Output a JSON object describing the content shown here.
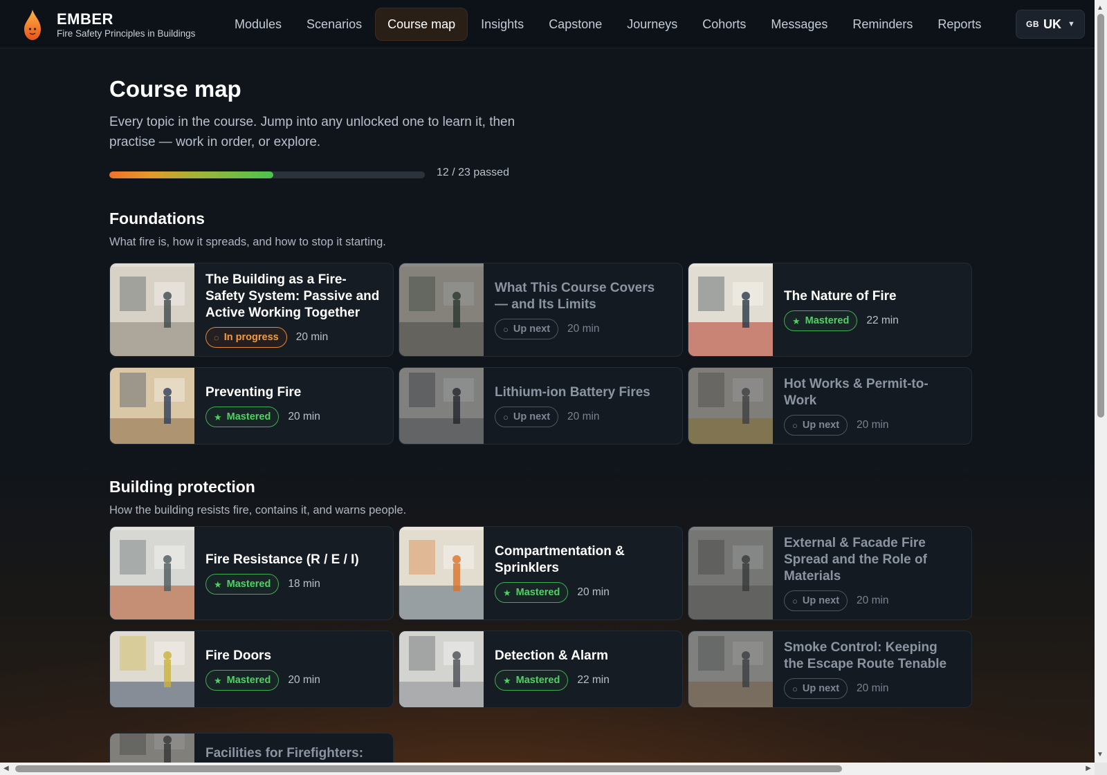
{
  "app": {
    "name": "EMBER",
    "subtitle": "Fire Safety Principles in Buildings",
    "logo_icon": "flame-icon"
  },
  "nav": {
    "items": [
      {
        "label": "Modules"
      },
      {
        "label": "Scenarios"
      },
      {
        "label": "Course map",
        "active": true
      },
      {
        "label": "Insights"
      },
      {
        "label": "Capstone"
      },
      {
        "label": "Journeys"
      },
      {
        "label": "Cohorts"
      },
      {
        "label": "Messages"
      },
      {
        "label": "Reminders"
      },
      {
        "label": "Reports"
      }
    ]
  },
  "language": {
    "flag": "GB",
    "code": "UK",
    "icon": "chevron-down-icon"
  },
  "page": {
    "title": "Course map",
    "description": "Every topic in the course. Jump into any unlocked one to learn it, then practise — work in order, or explore.",
    "progress": {
      "passed": 12,
      "total": 23,
      "fraction": 0.52,
      "label": "12 / 23 passed"
    }
  },
  "sections": [
    {
      "title": "Foundations",
      "description": "What fire is, how it spreads, and how to stop it starting.",
      "cards": [
        {
          "title": "The Building as a Fire-Safety System: Passive and Active Working Together",
          "status": "In progress",
          "status_type": "progress",
          "duration": "20 min",
          "image": "office-interior"
        },
        {
          "title": "What This Course Covers — and Its Limits",
          "status": "Up next",
          "status_type": "next",
          "duration": "20 min",
          "image": "meeting-room"
        },
        {
          "title": "The Nature of Fire",
          "status": "Mastered",
          "status_type": "mastered",
          "duration": "22 min",
          "image": "corridor-extinguisher"
        },
        {
          "title": "Preventing Fire",
          "status": "Mastered",
          "status_type": "mastered",
          "duration": "20 min",
          "image": "workshop"
        },
        {
          "title": "Lithium-ion Battery Fires",
          "status": "Up next",
          "status_type": "next",
          "duration": "20 min",
          "image": "battery-office"
        },
        {
          "title": "Hot Works & Permit-to-Work",
          "status": "Up next",
          "status_type": "next",
          "duration": "20 min",
          "image": "welder"
        }
      ]
    },
    {
      "title": "Building protection",
      "description": "How the building resists fire, contains it, and warns people.",
      "cards": [
        {
          "title": "Fire Resistance (R / E / I)",
          "status": "Mastered",
          "status_type": "mastered",
          "duration": "18 min",
          "image": "lab-floor"
        },
        {
          "title": "Compartmentation & Sprinklers",
          "status": "Mastered",
          "status_type": "mastered",
          "duration": "20 min",
          "image": "door-sprinkler"
        },
        {
          "title": "External & Facade Fire Spread and the Role of Materials",
          "status": "Up next",
          "status_type": "next",
          "duration": "20 min",
          "image": "scaffold"
        },
        {
          "title": "Fire Doors",
          "status": "Mastered",
          "status_type": "mastered",
          "duration": "20 min",
          "image": "fire-door"
        },
        {
          "title": "Detection & Alarm",
          "status": "Mastered",
          "status_type": "mastered",
          "duration": "22 min",
          "image": "kitchen"
        },
        {
          "title": "Smoke Control: Keeping the Escape Route Tenable",
          "status": "Up next",
          "status_type": "next",
          "duration": "20 min",
          "image": "stair-lobby"
        },
        {
          "title": "Facilities for Firefighters:",
          "status": "",
          "status_type": "next",
          "duration": "",
          "image": "building"
        }
      ]
    }
  ],
  "icons": {
    "mastered": "star-icon",
    "progress": "spinner-icon",
    "next": "circle-icon"
  },
  "colors": {
    "accent": "#f39a3c",
    "mastered": "#4fd264",
    "background": "#10151c"
  }
}
